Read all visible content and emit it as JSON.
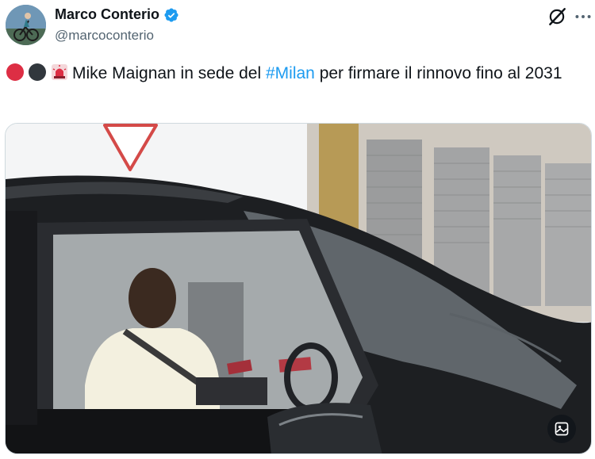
{
  "author": {
    "display_name": "Marco Conterio",
    "handle": "@marcoconterio",
    "verified": true
  },
  "tweet": {
    "emojis": [
      "red-circle",
      "black-circle",
      "rotating-light"
    ],
    "text_before": "Mike Maignan in sede del ",
    "hashtag": "#Milan",
    "text_after": " per firmare il rinnovo fino al 2031"
  },
  "colors": {
    "link": "#1d9bf0",
    "verified": "#1d9bf0",
    "secondary_text": "#536471"
  },
  "icons": {
    "grok": "grok-icon",
    "more": "more-dots-icon",
    "media_action": "media-edit-icon"
  }
}
